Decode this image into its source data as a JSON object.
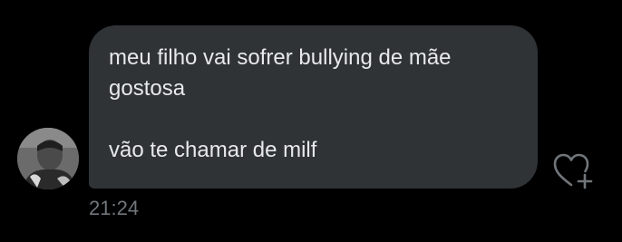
{
  "message": {
    "lines": [
      "meu filho vai sofrer bullying de mãe\ngostosa",
      "vão te chamar de milf"
    ],
    "timestamp": "21:24"
  },
  "icons": {
    "avatar": "user-avatar-photo",
    "like": "heart-plus-icon"
  },
  "colors": {
    "background": "#000000",
    "bubble": "#2f3336",
    "text": "#e7e9ea",
    "muted": "#71767b"
  }
}
